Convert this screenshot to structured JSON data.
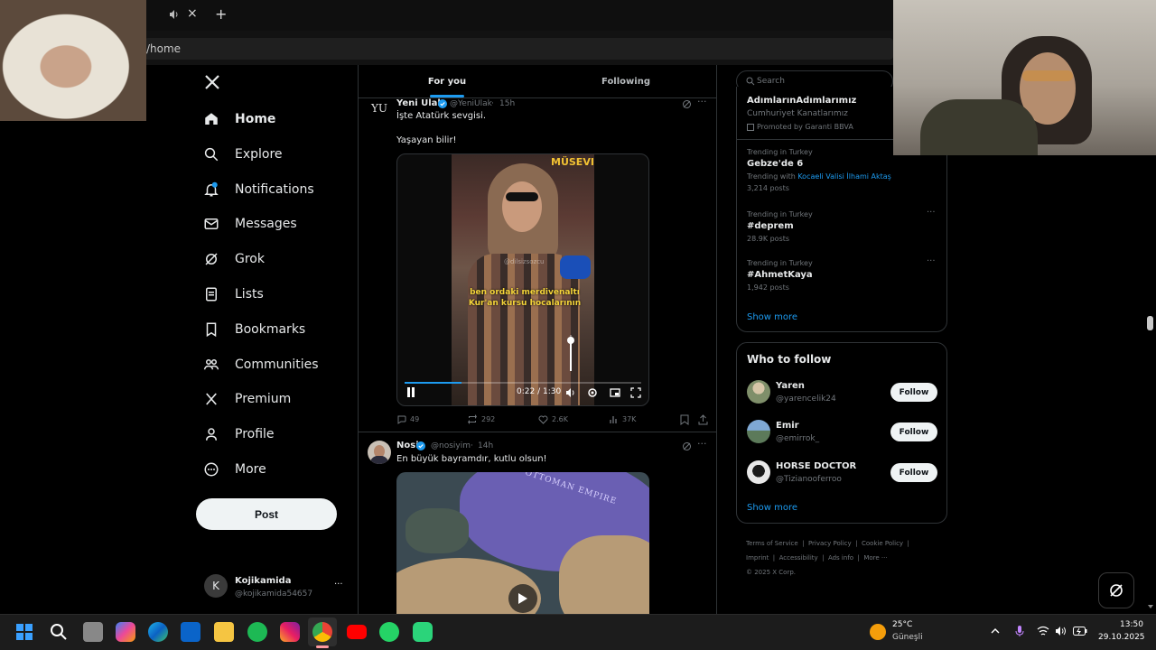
{
  "browser": {
    "address": "/home",
    "new_tab_label": "+",
    "tab_close_label": "×",
    "audio_icon": "speaker-icon"
  },
  "sidebar": {
    "logo_icon": "x-logo-icon",
    "items": [
      {
        "label": "Home",
        "icon": "home-icon"
      },
      {
        "label": "Explore",
        "icon": "search-icon"
      },
      {
        "label": "Notifications",
        "icon": "bell-icon"
      },
      {
        "label": "Messages",
        "icon": "mail-icon"
      },
      {
        "label": "Grok",
        "icon": "grok-icon"
      },
      {
        "label": "Lists",
        "icon": "list-icon"
      },
      {
        "label": "Bookmarks",
        "icon": "bookmark-icon"
      },
      {
        "label": "Communities",
        "icon": "people-icon"
      },
      {
        "label": "Premium",
        "icon": "x-logo-icon"
      },
      {
        "label": "Profile",
        "icon": "person-icon"
      },
      {
        "label": "More",
        "icon": "more-circle-icon"
      }
    ],
    "post_label": "Post",
    "account": {
      "initial": "K",
      "name": "Kojikamida",
      "handle": "@kojikamida54657",
      "more": "···"
    }
  },
  "feed": {
    "tabs": [
      "For you",
      "Following"
    ],
    "tweets": [
      {
        "avatar_text": "YU",
        "name": "Yeni Ulak",
        "handle": "@YeniUlak",
        "time": "15h",
        "text1": "İşte Atatürk sevgisi.",
        "text2": "Yaşayan bilir!",
        "video": {
          "sign_text": "MÜSEVI",
          "caption_line1": "ben ordaki merdivenaltı",
          "caption_line2": "Kur'an kursu hocalarının",
          "watermark": "@dilsizsozcu",
          "time": "0:22 / 1:30",
          "progress": 0.24,
          "volume_level": 0.85
        },
        "stats": {
          "replies": "49",
          "reposts": "292",
          "likes": "2.6K",
          "views": "37K"
        }
      },
      {
        "name": "Nosi",
        "handle": "@nosiyim",
        "time": "14h",
        "text1": "En büyük bayramdır, kutlu olsun!",
        "map_label": "OTTOMAN EMPIRE"
      }
    ]
  },
  "right": {
    "search_placeholder": "Search",
    "promo": {
      "title": "AdımlarınAdımlarımız",
      "sub": "Cumhuriyet Kanatlarımız",
      "promoted": "Promoted by Garanti BBVA"
    },
    "trends": [
      {
        "context": "Trending in Turkey",
        "name": "Gebze'de 6",
        "with_prefix": "Trending with",
        "with_link": "Kocaeli Valisi İlhami Aktaş",
        "posts": "3,214 posts"
      },
      {
        "context": "Trending in Turkey",
        "name": "#deprem",
        "posts": "28.9K posts"
      },
      {
        "context": "Trending in Turkey",
        "name": "#AhmetKaya",
        "posts": "1,942 posts"
      }
    ],
    "trends_more": "Show more",
    "who_title": "Who to follow",
    "who": [
      {
        "name": "Yaren",
        "handle": "@yarencelik24",
        "btn": "Follow"
      },
      {
        "name": "Emir",
        "handle": "@emirrok_",
        "btn": "Follow"
      },
      {
        "name": "HORSE DOCTOR",
        "handle": "@Tizianooferroo",
        "btn": "Follow"
      }
    ],
    "who_more": "Show more",
    "footer": [
      "Terms of Service",
      "Privacy Policy",
      "Cookie Policy",
      "Imprint",
      "Accessibility",
      "Ads info",
      "More ···",
      "© 2025 X Corp."
    ]
  },
  "taskbar": {
    "weather_temp": "25°C",
    "weather_desc": "Güneşli",
    "time": "13:50",
    "date": "29.10.2025"
  },
  "colors": {
    "accent": "#1d9bf0",
    "bg": "#000000",
    "border": "#2f3336",
    "muted": "#71767b"
  }
}
